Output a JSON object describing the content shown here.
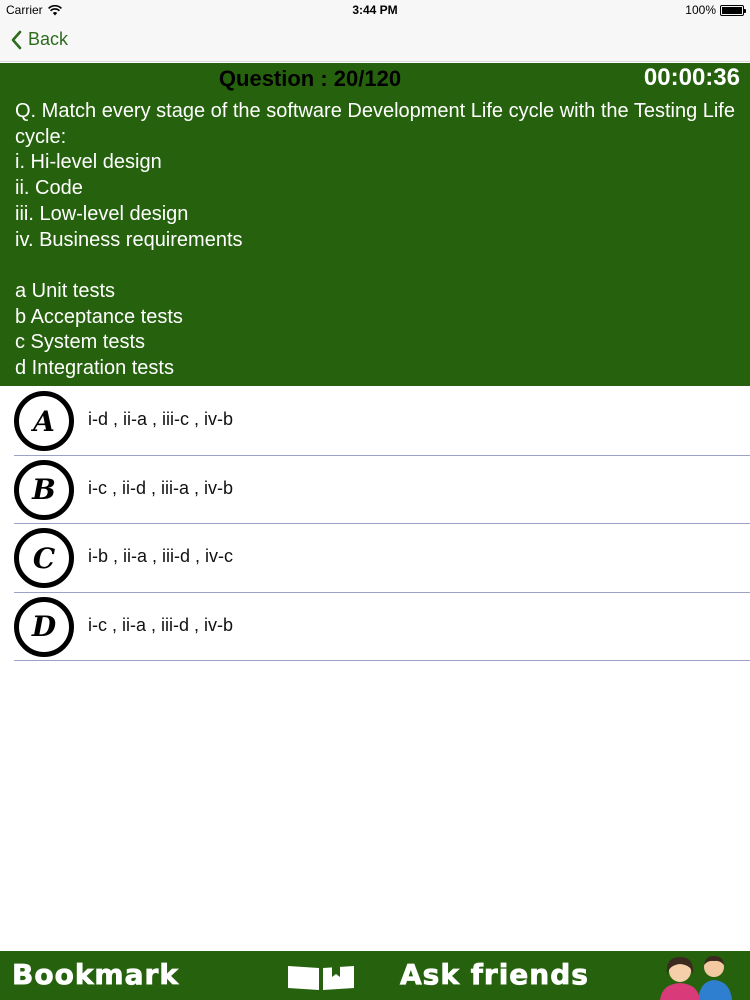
{
  "status_bar": {
    "carrier": "Carrier",
    "time": "3:44 PM",
    "battery_text": "100%",
    "battery_level": 1.0
  },
  "nav": {
    "back_label": "Back"
  },
  "question": {
    "counter": "Question : 20/120",
    "timer": "00:00:36",
    "text": "Q. Match every stage of the software Development Life cycle with the Testing Life cycle:\ni. Hi-level design\nii. Code\niii. Low-level design\niv. Business requirements\n\na Unit tests\nb Acceptance tests\nc System tests\nd Integration tests"
  },
  "options": [
    {
      "letter": "A",
      "text": "i-d , ii-a , iii-c , iv-b"
    },
    {
      "letter": "B",
      "text": "i-c , ii-d , iii-a , iv-b"
    },
    {
      "letter": "C",
      "text": "i-b , ii-a , iii-d , iv-c"
    },
    {
      "letter": "D",
      "text": "i-c , ii-a , iii-d , iv-b"
    }
  ],
  "toolbar": {
    "bookmark_label": "Bookmark",
    "ask_label": "Ask friends",
    "book_icon": "book-icon",
    "friends_icon": "friends-icon"
  },
  "colors": {
    "panel_green": "#26620e",
    "accent_green": "#2e6b1f"
  }
}
